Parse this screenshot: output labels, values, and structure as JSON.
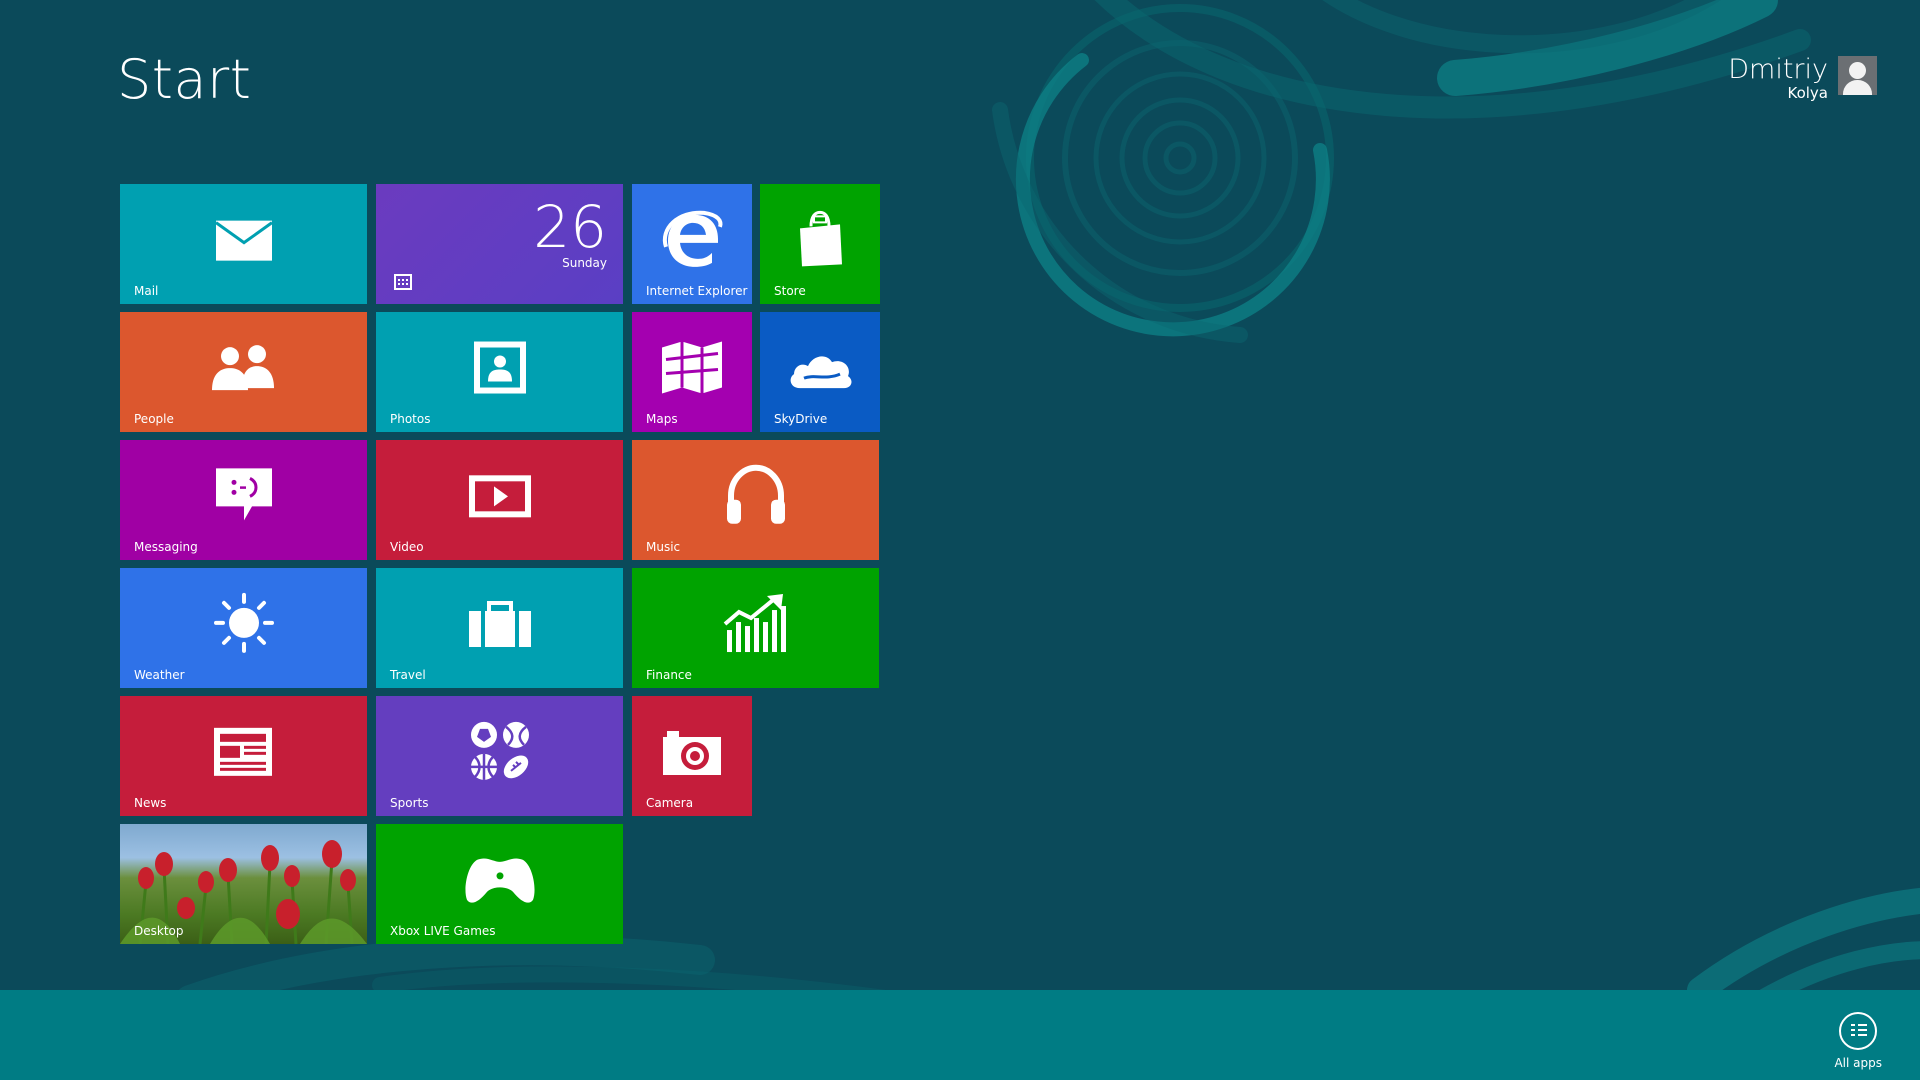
{
  "screen": {
    "title": "Start",
    "user": {
      "name": "Dmitriy",
      "subtitle": "Kolya"
    }
  },
  "colors": {
    "background": "#0b4a5a",
    "bar": "#007c84",
    "ring": "#0a7077"
  },
  "tiles": {
    "mail": {
      "label": "Mail",
      "icon": "mail-icon",
      "color": "#00a0b1"
    },
    "calendar": {
      "label": "",
      "day": "26",
      "weekday": "Sunday",
      "icon": "calendar-icon",
      "color": "#643ebf"
    },
    "ie": {
      "label": "Internet Explorer",
      "icon": "internet-explorer-icon",
      "color": "#2f72e8"
    },
    "store": {
      "label": "Store",
      "icon": "store-bag-icon",
      "color": "#00a300"
    },
    "people": {
      "label": "People",
      "icon": "people-icon",
      "color": "#dc572e"
    },
    "photos": {
      "label": "Photos",
      "icon": "photos-icon",
      "color": "#00a0b1"
    },
    "maps": {
      "label": "Maps",
      "icon": "maps-icon",
      "color": "#a400b0"
    },
    "skydrive": {
      "label": "SkyDrive",
      "icon": "skydrive-cloud-icon",
      "color": "#0a5bc4"
    },
    "messaging": {
      "label": "Messaging",
      "icon": "messaging-icon",
      "color": "#a000a4"
    },
    "video": {
      "label": "Video",
      "icon": "video-icon",
      "color": "#c51d3b"
    },
    "music": {
      "label": "Music",
      "icon": "headphones-icon",
      "color": "#dc572e"
    },
    "weather": {
      "label": "Weather",
      "icon": "sun-icon",
      "color": "#2f72e8"
    },
    "travel": {
      "label": "Travel",
      "icon": "suitcase-icon",
      "color": "#00a0b1"
    },
    "finance": {
      "label": "Finance",
      "icon": "chart-up-icon",
      "color": "#00a300"
    },
    "news": {
      "label": "News",
      "icon": "newspaper-icon",
      "color": "#c51d3b"
    },
    "sports": {
      "label": "Sports",
      "icon": "sports-balls-icon",
      "color": "#643ebf"
    },
    "camera": {
      "label": "Camera",
      "icon": "camera-icon",
      "color": "#c51d3b"
    },
    "desktop": {
      "label": "Desktop",
      "icon": "desktop-wallpaper",
      "color": "#5a8a2a"
    },
    "xbox": {
      "label": "Xbox LIVE Games",
      "icon": "xbox-controller-icon",
      "color": "#00a300"
    }
  },
  "bottom_bar": {
    "all_apps_label": "All apps",
    "all_apps_icon": "all-apps-icon"
  }
}
